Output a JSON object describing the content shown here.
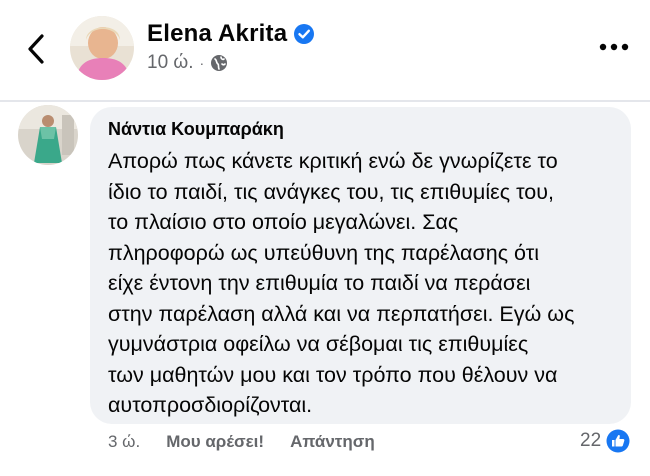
{
  "header": {
    "name": "Elena Akrita",
    "time": "10 ώ.",
    "dot": "·"
  },
  "comment": {
    "author": "Νάντια Κουμπαράκη",
    "lines": [
      "Απορώ πως κάνετε κριτική ενώ δε γνωρίζετε το",
      "ίδιο το παιδί, τις ανάγκες του, τις επιθυμίες του,",
      "το πλαίσιο στο οποίο μεγαλώνει. Σας",
      "πληροφορώ ως υπεύθυνη της παρέλασης ότι",
      "είχε έντονη την επιθυμία το παιδί να περάσει",
      "στην παρέλαση αλλά και να περπατήσει. Εγώ ως",
      "γυμνάστρια οφείλω να σέβομαι τις επιθυμίες",
      "των μαθητών μου και τον τρόπο που θέλουν να",
      "αυτοπροσδιορίζονται."
    ],
    "time": "3 ώ.",
    "like_label": "Μου αρέσει!",
    "reply_label": "Απάντηση",
    "reaction_count": "22"
  },
  "colors": {
    "accent": "#1877f2",
    "bubble": "#f0f2f5",
    "secondary_text": "#65676b"
  },
  "icons": {
    "back": "chevron-left-icon",
    "verified": "verified-badge-icon",
    "privacy": "globe-icon",
    "more": "more-dots-icon",
    "reaction": "thumbs-up-icon"
  }
}
